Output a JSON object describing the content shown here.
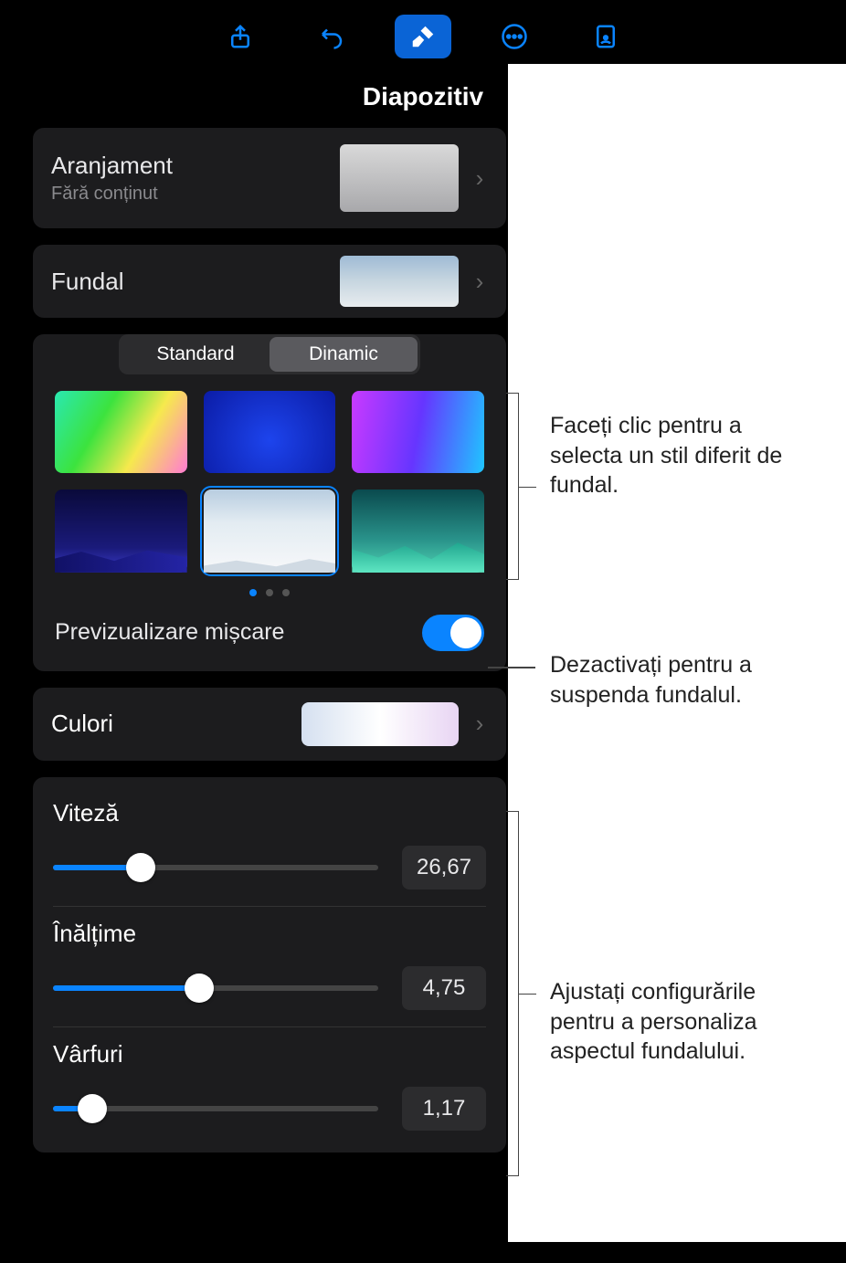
{
  "header": {
    "title": "Diapozitiv"
  },
  "toolbar": {
    "icons": [
      "share",
      "undo",
      "brush",
      "more",
      "document-view"
    ]
  },
  "rows": {
    "arrangement": {
      "label": "Aranjament",
      "sub": "Fără conținut"
    },
    "background": {
      "label": "Fundal"
    },
    "colors": {
      "label": "Culori"
    }
  },
  "seg": {
    "standard": "Standard",
    "dynamic": "Dinamic"
  },
  "preview": {
    "label": "Previzualizare mișcare",
    "on": true
  },
  "sliders": {
    "speed": {
      "label": "Viteză",
      "value": "26,67",
      "pct": 27
    },
    "height": {
      "label": "Înălțime",
      "value": "4,75",
      "pct": 45
    },
    "peaks": {
      "label": "Vârfuri",
      "value": "1,17",
      "pct": 12
    }
  },
  "ann": {
    "a1": "Faceți clic pentru a selecta un stil diferit de fundal.",
    "a2": "Dezactivați pentru a suspenda fundalul.",
    "a3": "Ajustați configurările pentru a personaliza aspectul fundalului."
  }
}
